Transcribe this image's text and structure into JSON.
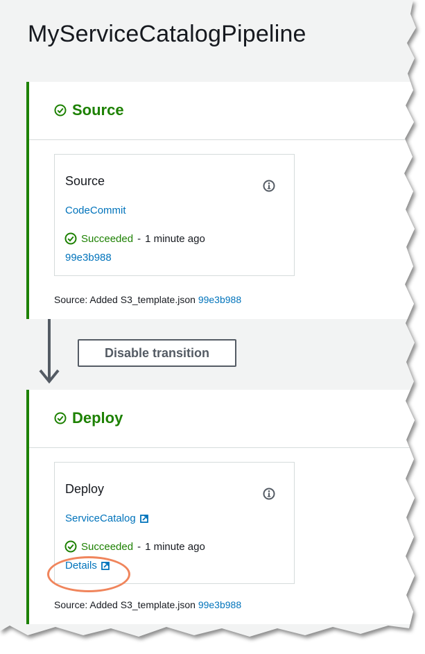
{
  "page": {
    "title": "MyServiceCatalogPipeline"
  },
  "stages": {
    "source": {
      "name": "Source",
      "action": {
        "name": "Source",
        "provider": "CodeCommit",
        "status": "Succeeded",
        "separator": "-",
        "time": "1 minute ago",
        "link": "99e3b988"
      },
      "footer_prefix": "Source: Added S3_template.json",
      "footer_commit": "99e3b988"
    },
    "deploy": {
      "name": "Deploy",
      "action": {
        "name": "Deploy",
        "provider": "ServiceCatalog",
        "status": "Succeeded",
        "separator": "-",
        "time": "1 minute ago",
        "link": "Details"
      },
      "footer_prefix": "Source: Added S3_template.json",
      "footer_commit": "99e3b988"
    }
  },
  "transition": {
    "button_label": "Disable transition"
  },
  "icons": {
    "stage_status": "check-circle-icon",
    "info": "info-icon",
    "external_link": "external-link-icon",
    "arrow": "arrow-down-icon"
  },
  "colors": {
    "success": "#1d8102",
    "link": "#0073bb",
    "highlight": "#f0855c",
    "text": "#16191f",
    "background": "#f2f3f3"
  }
}
